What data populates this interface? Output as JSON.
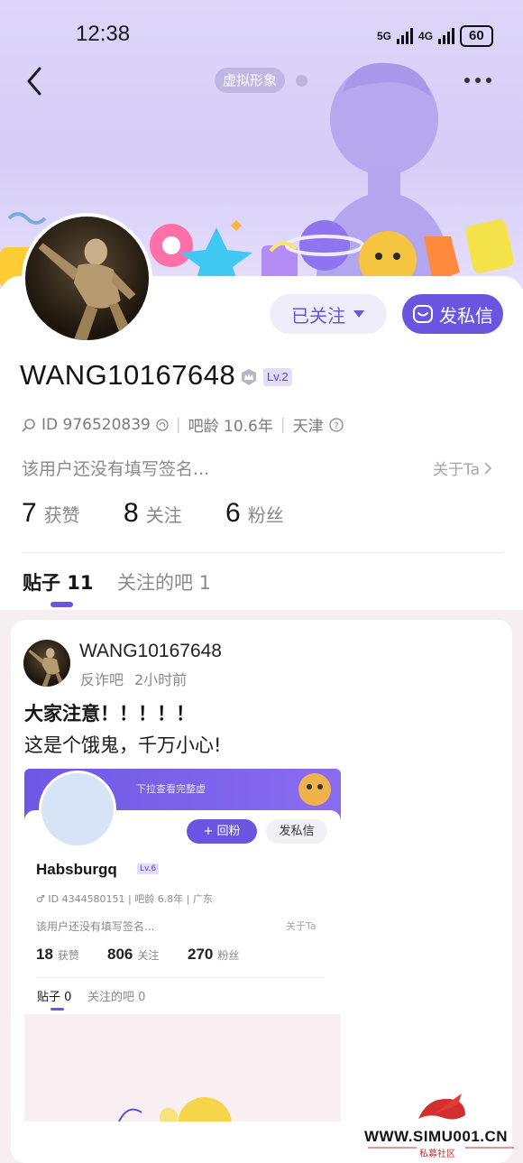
{
  "status_bar": {
    "time": "12:38",
    "net1": "5G",
    "net2": "4G",
    "battery": "60"
  },
  "header": {
    "back_icon": "chevron-left-icon",
    "more_icon": "more-dots-icon",
    "avatar_label": "虚拟形象"
  },
  "profile": {
    "username": "WANG10167648",
    "level": "Lv.2",
    "id_text": "ID 976520839",
    "bar_age": "吧龄 10.6年",
    "location": "天津",
    "signature": "该用户还没有填写签名...",
    "about_link": "关于Ta",
    "follow_label": "已关注",
    "dm_label": "发私信",
    "stats": [
      {
        "num": "7",
        "label": "获赞"
      },
      {
        "num": "8",
        "label": "关注"
      },
      {
        "num": "6",
        "label": "粉丝"
      }
    ]
  },
  "tabs": {
    "posts": "贴子 11",
    "forums": "关注的吧 1"
  },
  "post": {
    "author": "WANG10167648",
    "forum": "反诈吧",
    "time": "2小时前",
    "title": "大家注意！！！！！",
    "body": "这是个饿鬼，千万小心!",
    "screenshot": {
      "hint": "下拉查看完整虚",
      "name": "Habsburgq",
      "level": "Lv.6",
      "hui_label": "+ 回粉",
      "dm_label": "发私信",
      "meta": "♂  ID 4344580151  |  吧龄 6.8年  |  广东",
      "signature": "该用户还没有填写签名...",
      "about": "关于Ta",
      "stats": [
        {
          "num": "18",
          "label": "获赞"
        },
        {
          "num": "806",
          "label": "关注"
        },
        {
          "num": "270",
          "label": "粉丝"
        }
      ],
      "tab_posts": "贴子 0",
      "tab_forums": "关注的吧 0"
    }
  },
  "watermark": {
    "site": "WWW.SIMU001.CN",
    "sub": "私募社区"
  },
  "colors": {
    "accent": "#6b55e0",
    "banner": "#d6cdf8"
  }
}
